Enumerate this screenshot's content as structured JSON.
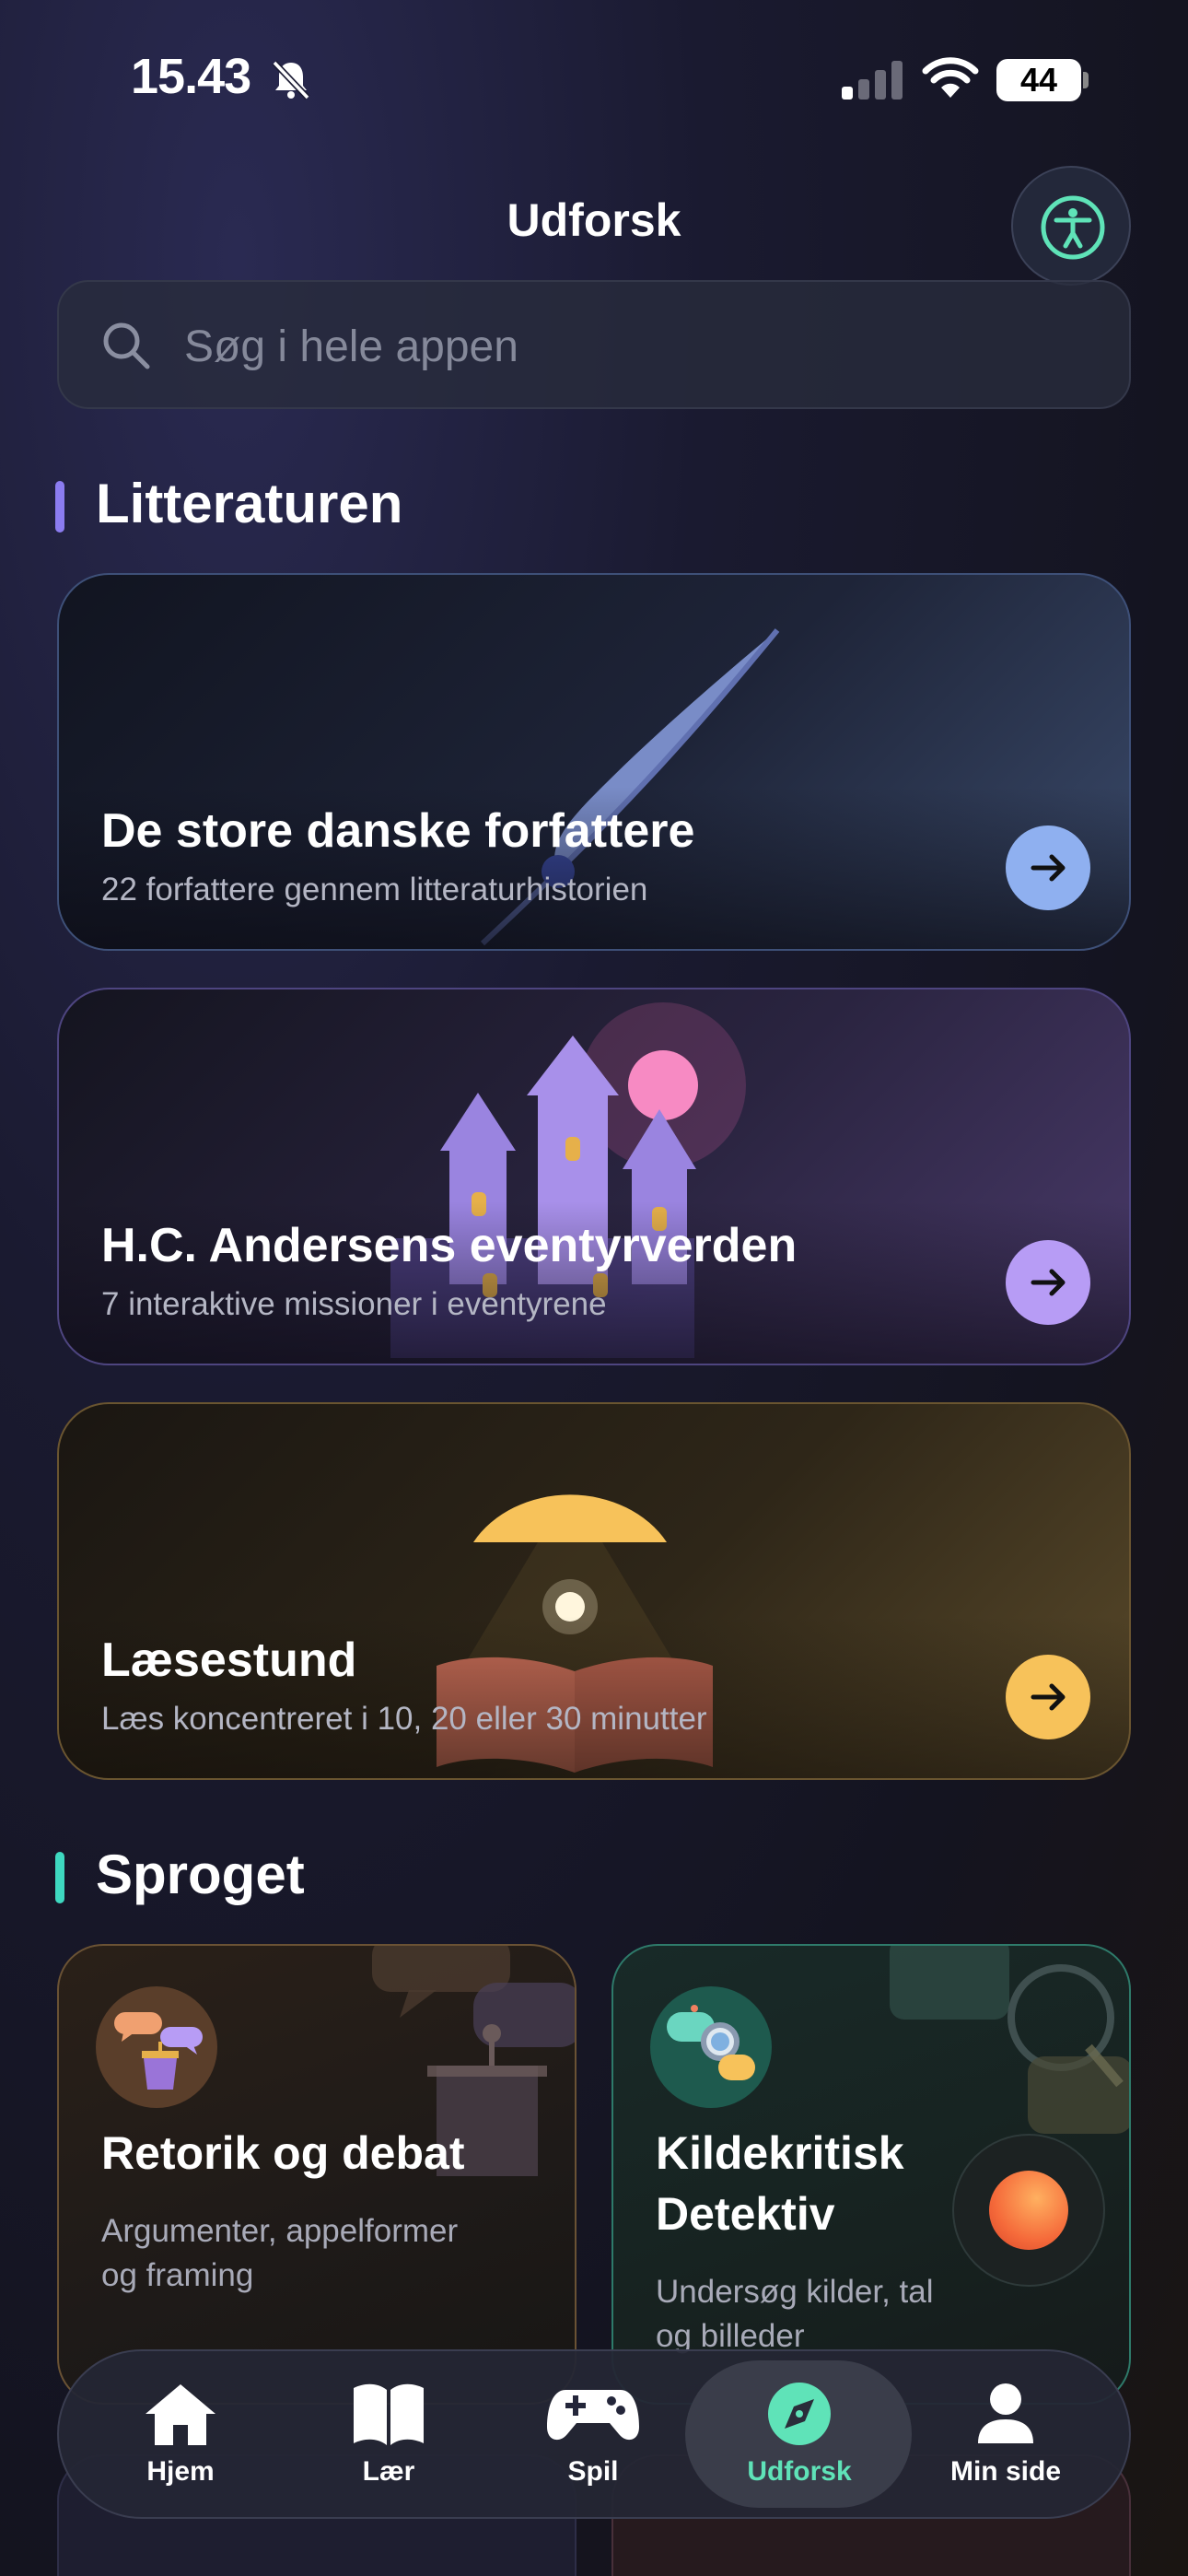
{
  "status_bar": {
    "time": "15.43",
    "battery": "44"
  },
  "header": {
    "title": "Udforsk"
  },
  "search": {
    "placeholder": "Søg i hele appen"
  },
  "sections": {
    "literature": {
      "title": "Litteraturen"
    },
    "language": {
      "title": "Sproget"
    }
  },
  "cards": [
    {
      "title": "De store danske forfattere",
      "subtitle": "22 forfattere gennem litteraturhistorien",
      "accent": "#8fb0f0"
    },
    {
      "title": "H.C. Andersens eventyrverden",
      "subtitle": "7 interaktive missioner i eventyrene",
      "accent": "#b79cf5"
    },
    {
      "title": "Læsestund",
      "subtitle": "Læs koncentreret i 10, 20 eller 30 minutter",
      "accent": "#f7c25a"
    }
  ],
  "tiles": [
    {
      "title": "Retorik og debat",
      "subtitle_line1": "Argumenter, appelformer",
      "subtitle_line2": "og framing",
      "accent": "#d4a06a"
    },
    {
      "title_line1": "Kildekritisk",
      "title_line2": "Detektiv",
      "subtitle_line1": "Undersøg kilder, tal",
      "subtitle_line2": "og billeder",
      "accent": "#3ec9a8"
    }
  ],
  "nav": {
    "items": [
      {
        "label": "Hjem",
        "icon": "home-icon"
      },
      {
        "label": "Lær",
        "icon": "book-icon"
      },
      {
        "label": "Spil",
        "icon": "gamepad-icon"
      },
      {
        "label": "Udforsk",
        "icon": "compass-icon",
        "active": true
      },
      {
        "label": "Min side",
        "icon": "person-icon"
      }
    ],
    "active_color": "#5fe3b8"
  }
}
